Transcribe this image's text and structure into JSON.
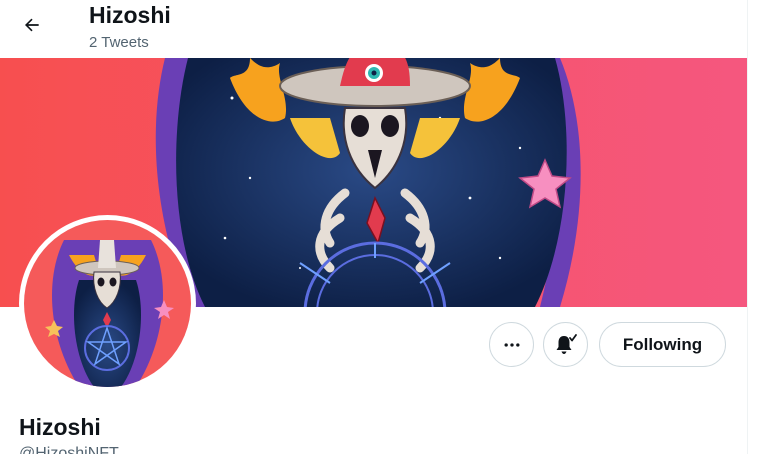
{
  "header": {
    "title": "Hizoshi",
    "subtitle": "2 Tweets",
    "back_icon": "arrow-left-icon"
  },
  "banner": {
    "background_left": "#f74f4f",
    "background_right": "#f5577f"
  },
  "actions": {
    "more_icon": "more-horizontal-icon",
    "notify_icon": "bell-check-icon",
    "follow_label": "Following"
  },
  "profile": {
    "name": "Hizoshi",
    "handle": "@HizoshiNFT"
  },
  "colors": {
    "text_primary": "#0f1419",
    "text_secondary": "#536471",
    "border": "#cfd9de"
  }
}
